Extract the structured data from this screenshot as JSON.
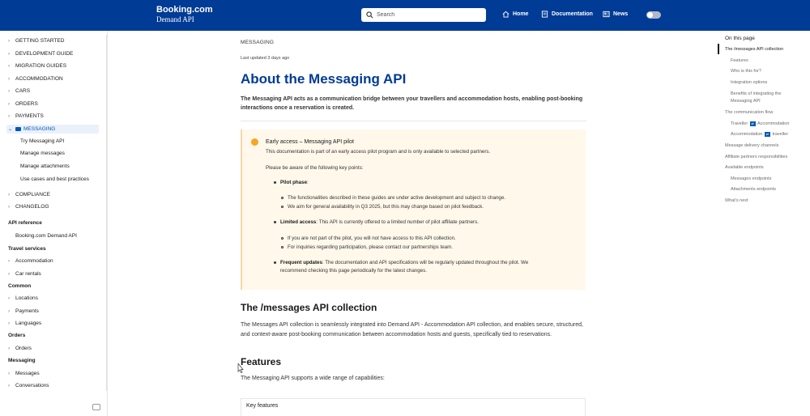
{
  "header": {
    "brand": "Booking.com",
    "product": "Demand API",
    "search_placeholder": "Search",
    "nav": [
      {
        "label": "Home",
        "icon": "home-icon"
      },
      {
        "label": "Documentation",
        "icon": "document-icon"
      },
      {
        "label": "News",
        "icon": "news-icon"
      }
    ],
    "theme_toggle": "toggle"
  },
  "sidebar": {
    "sections": [
      "GETTING STARTED",
      "DEVELOPMENT GUIDE",
      "MIGRATION GUIDES",
      "ACCOMMODATION",
      "CARS",
      "ORDERS",
      "PAYMENTS",
      "MESSAGING"
    ],
    "messaging_children": [
      "Try Messaging API",
      "Manage messages",
      "Manage attachments",
      "Use cases and best practices"
    ],
    "after_sections": [
      "COMPLIANCE",
      "CHANGELOG"
    ],
    "api_reference": {
      "heading": "API reference",
      "item": "Booking.com Demand API",
      "travel_services": {
        "heading": "Travel services",
        "items": [
          "Accommodation",
          "Car rentals"
        ]
      },
      "common": {
        "heading": "Common",
        "items": [
          "Locations",
          "Payments",
          "Languages"
        ]
      },
      "orders": {
        "heading": "Orders",
        "items": [
          "Orders"
        ]
      },
      "messaging": {
        "heading": "Messaging",
        "items": [
          "Messages",
          "Conversations"
        ]
      }
    }
  },
  "main": {
    "breadcrumb": "MESSAGING",
    "updated": "Last updated 3 days ago",
    "title": "About the Messaging API",
    "lead": "The Messaging API acts as a communication bridge between your travellers and accommodation hosts, enabling post-booking interactions once a reservation is created.",
    "callout": {
      "title": "Early access – Messaging API pilot",
      "intro": "This documentation is part of an early access pilot program and is only available to selected partners.",
      "aware": "Please be aware of the following key points:",
      "pilot_phase": "Pilot phase",
      "pilot_sub": [
        "The functionalities described in these guides are under active development and subject to change.",
        "We aim for general availability in Q3 2025, but this may change based on pilot feedback."
      ],
      "limited_access": "Limited access",
      "limited_text": ": This API is currently offered to a limited number of pilot affiliate partners.",
      "limited_sub": [
        "If you are not part of the pilot, you will not have access to this API collection.",
        "For inquiries regarding participation, please contact our partnerships team."
      ],
      "frequent_updates": "Frequent updates",
      "frequent_text_1": ": The documentation and API specifications will be regularly updated throughout the pilot. We",
      "frequent_text_2": "recommend checking this page periodically for the latest changes."
    },
    "collection_heading": "The /messages API collection",
    "collection_text": "The Messages API collection is seamlessly integrated into Demand API - Accommodation API collection, and enables secure, structured, and context-aware post-booking communication between accommodation hosts and guests, specifically tied to reservations.",
    "features_heading": "Features",
    "features_text": "The Messaging API supports a wide range of capabilities:",
    "key_features": "Key features"
  },
  "toc": {
    "title": "On this page",
    "items": [
      {
        "label": "The /messages API collection",
        "active": true
      },
      {
        "label": "Features"
      },
      {
        "label": "Who is this for?"
      },
      {
        "label": "Integration options"
      },
      {
        "label": "Benefits of integrating the"
      },
      {
        "label": "Messaging API"
      },
      {
        "label": "The communication flow"
      },
      {
        "label": "Message delivery channels"
      },
      {
        "label": "Affiliate partners responsibilities"
      },
      {
        "label": "Available endpoints"
      },
      {
        "label": "Messages endpoints"
      },
      {
        "label": "Attachments endpoints"
      },
      {
        "label": "What's next"
      }
    ],
    "flow_1a": "Traveller",
    "flow_1b": "Accommodation",
    "flow_2a": "Accommodation",
    "flow_2b": "traveller",
    "arrow": "⇄"
  }
}
